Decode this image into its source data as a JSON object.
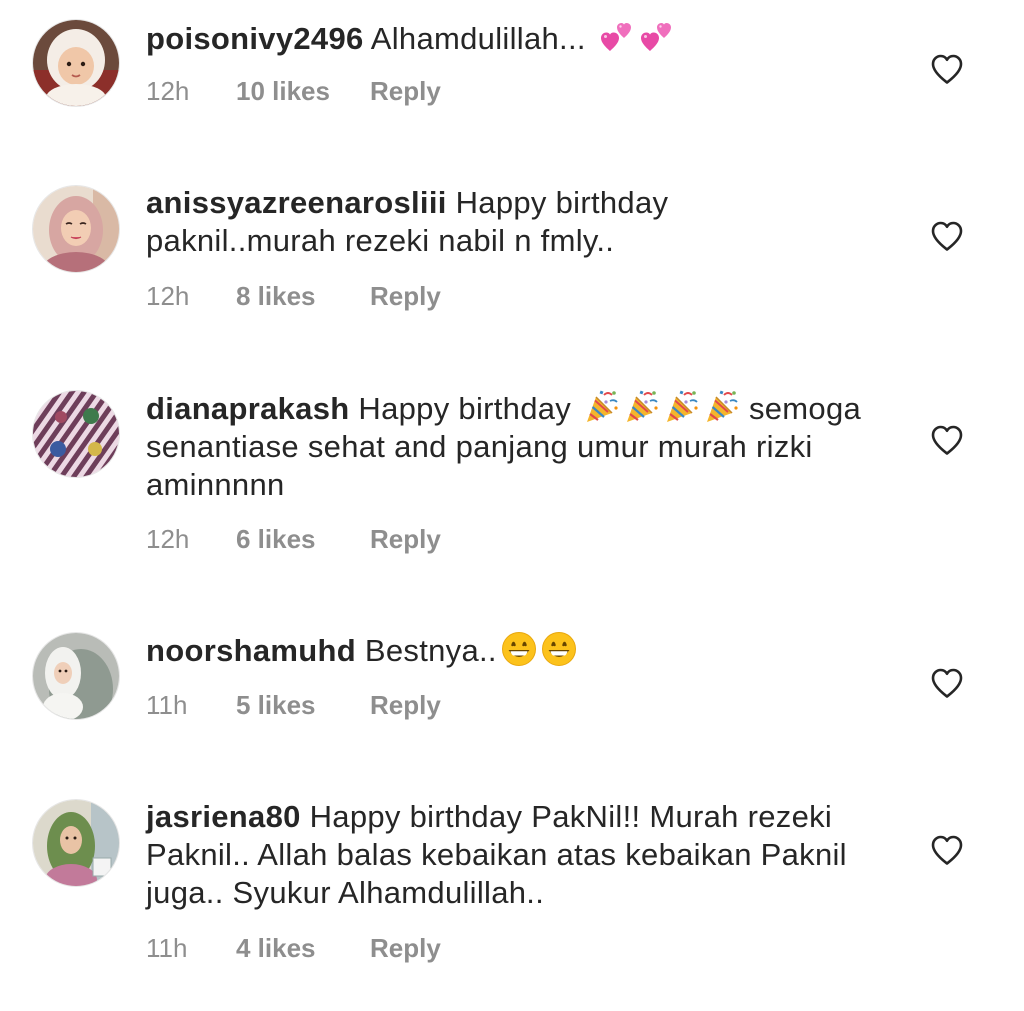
{
  "comments": [
    {
      "username": "poisonivy2496",
      "text": "Alhamdulillah...",
      "emojis": [
        "two-hearts",
        "two-hearts"
      ],
      "time": "12h",
      "likes": "10 likes",
      "reply": "Reply"
    },
    {
      "username": "anissyazreenarosliii",
      "text": "Happy birthday paknil..murah rezeki nabil n fmly..",
      "emojis": [],
      "time": "12h",
      "likes": "8 likes",
      "reply": "Reply"
    },
    {
      "username": "dianaprakash",
      "text_before": "Happy birthday",
      "emojis": [
        "party-popper",
        "party-popper",
        "party-popper",
        "party-popper"
      ],
      "text_after": "semoga senantiase sehat and panjang umur murah rizki aminnnnn",
      "time": "12h",
      "likes": "6 likes",
      "reply": "Reply"
    },
    {
      "username": "noorshamuhd",
      "text": "Bestnya..",
      "emojis": [
        "grinning-face",
        "grinning-face"
      ],
      "time": "11h",
      "likes": "5 likes",
      "reply": "Reply"
    },
    {
      "username": "jasriena80",
      "text": "Happy birthday PakNil!! Murah rezeki Paknil.. Allah balas kebaikan atas kebaikan Paknil juga.. Syukur Alhamdulillah..",
      "emojis": [],
      "time": "11h",
      "likes": "4 likes",
      "reply": "Reply"
    }
  ],
  "colors": {
    "text": "#262626",
    "meta": "#8e8e8e",
    "heart_outline": "#262626"
  },
  "icons": {
    "like": "heart-outline-icon",
    "avatar": "avatar-photo"
  }
}
